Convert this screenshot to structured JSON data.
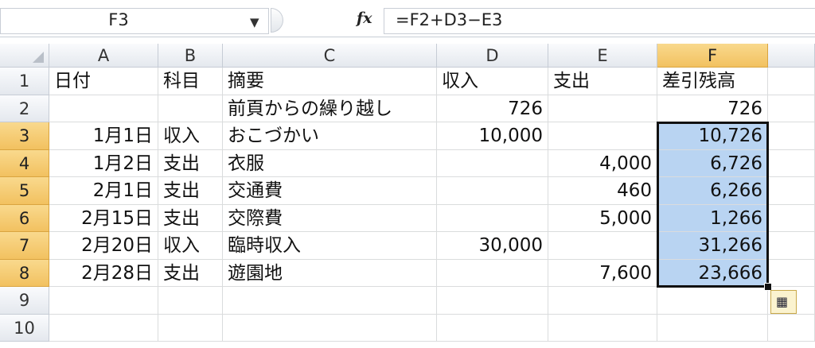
{
  "formula_bar": {
    "name_box": "F3",
    "dropdown_glyph": "▼",
    "fx_label": "fx",
    "formula": "=F2+D3−E3"
  },
  "columns": [
    "A",
    "B",
    "C",
    "D",
    "E",
    "F"
  ],
  "selected_column": "F",
  "row_numbers": [
    "1",
    "2",
    "3",
    "4",
    "5",
    "6",
    "7",
    "8",
    "9",
    "10"
  ],
  "selected_rows": [
    "3",
    "4",
    "5",
    "6",
    "7",
    "8"
  ],
  "rows": [
    {
      "A": "日付",
      "B": "科目",
      "C": "摘要",
      "D": "収入",
      "E": "支出",
      "F": "差引残高"
    },
    {
      "A": "",
      "B": "",
      "C": "前頁からの繰り越し",
      "D": "726",
      "E": "",
      "F": "726"
    },
    {
      "A": "1月1日",
      "B": "収入",
      "C": "おこづかい",
      "D": "10,000",
      "E": "",
      "F": "10,726"
    },
    {
      "A": "1月2日",
      "B": "支出",
      "C": "衣服",
      "D": "",
      "E": "4,000",
      "F": "6,726"
    },
    {
      "A": "2月1日",
      "B": "支出",
      "C": "交通費",
      "D": "",
      "E": "460",
      "F": "6,266"
    },
    {
      "A": "2月15日",
      "B": "支出",
      "C": "交際費",
      "D": "",
      "E": "5,000",
      "F": "1,266"
    },
    {
      "A": "2月20日",
      "B": "収入",
      "C": "臨時収入",
      "D": "30,000",
      "E": "",
      "F": "31,266"
    },
    {
      "A": "2月28日",
      "B": "支出",
      "C": "遊園地",
      "D": "",
      "E": "7,600",
      "F": "23,666"
    },
    {
      "A": "",
      "B": "",
      "C": "",
      "D": "",
      "E": "",
      "F": ""
    },
    {
      "A": "",
      "B": "",
      "C": "",
      "D": "",
      "E": "",
      "F": ""
    }
  ],
  "quick_analysis_icon": "quick-analysis-icon",
  "colors": {
    "selection_fill": "#b9d4f2",
    "header_selected": "#f2c160"
  }
}
